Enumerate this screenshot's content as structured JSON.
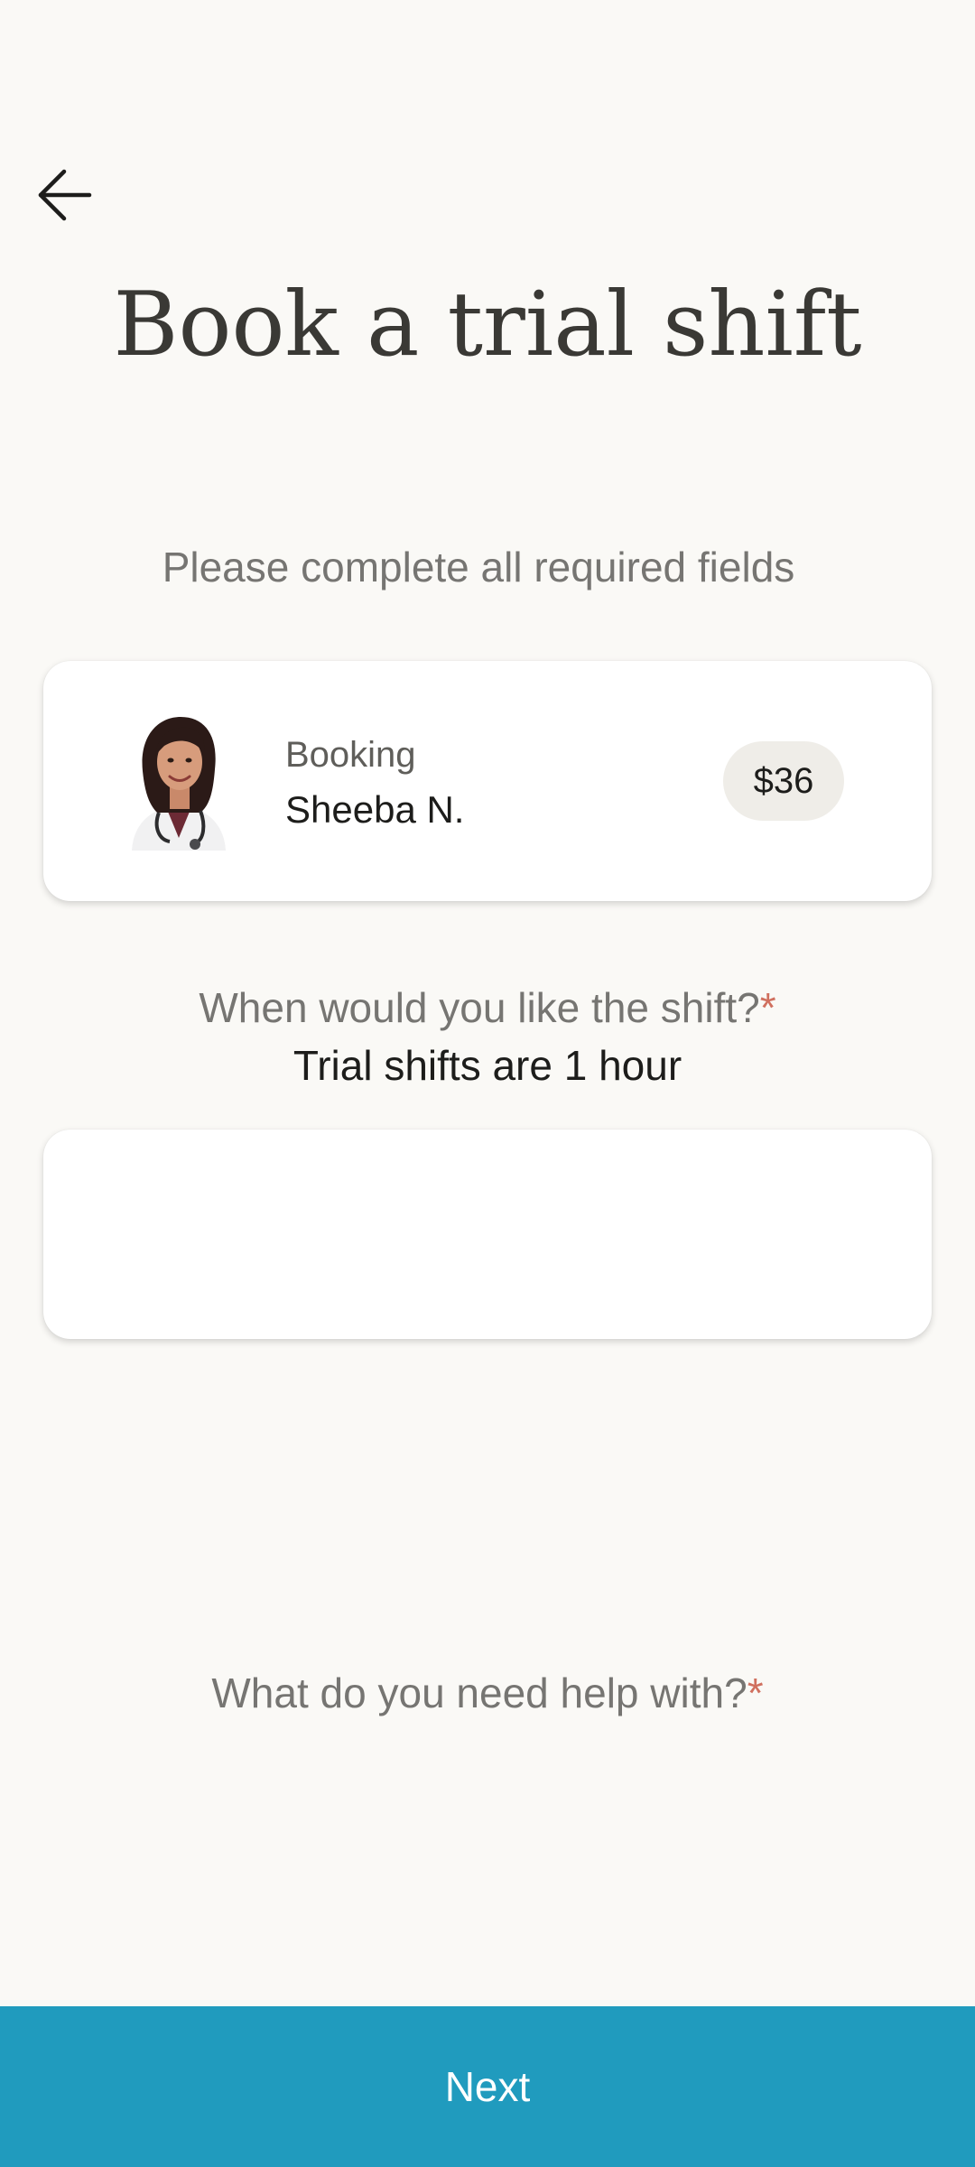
{
  "header": {
    "back_icon": "arrow-left-icon",
    "title": "Book a trial shift"
  },
  "instructions": "Please complete all required fields",
  "booking": {
    "label": "Booking",
    "name": "Sheeba N.",
    "price": "$36",
    "avatar_icon": "caregiver-avatar"
  },
  "shift_question": {
    "label": "When would you like the shift?",
    "required_mark": "*",
    "note": "Trial shifts are 1 hour"
  },
  "help_question": {
    "label": "What do you need help with?",
    "required_mark": "*"
  },
  "footer": {
    "next_label": "Next"
  },
  "colors": {
    "background": "#faf9f6",
    "accent": "#209bbe",
    "required": "#d0705f",
    "price_badge": "#efede8"
  }
}
